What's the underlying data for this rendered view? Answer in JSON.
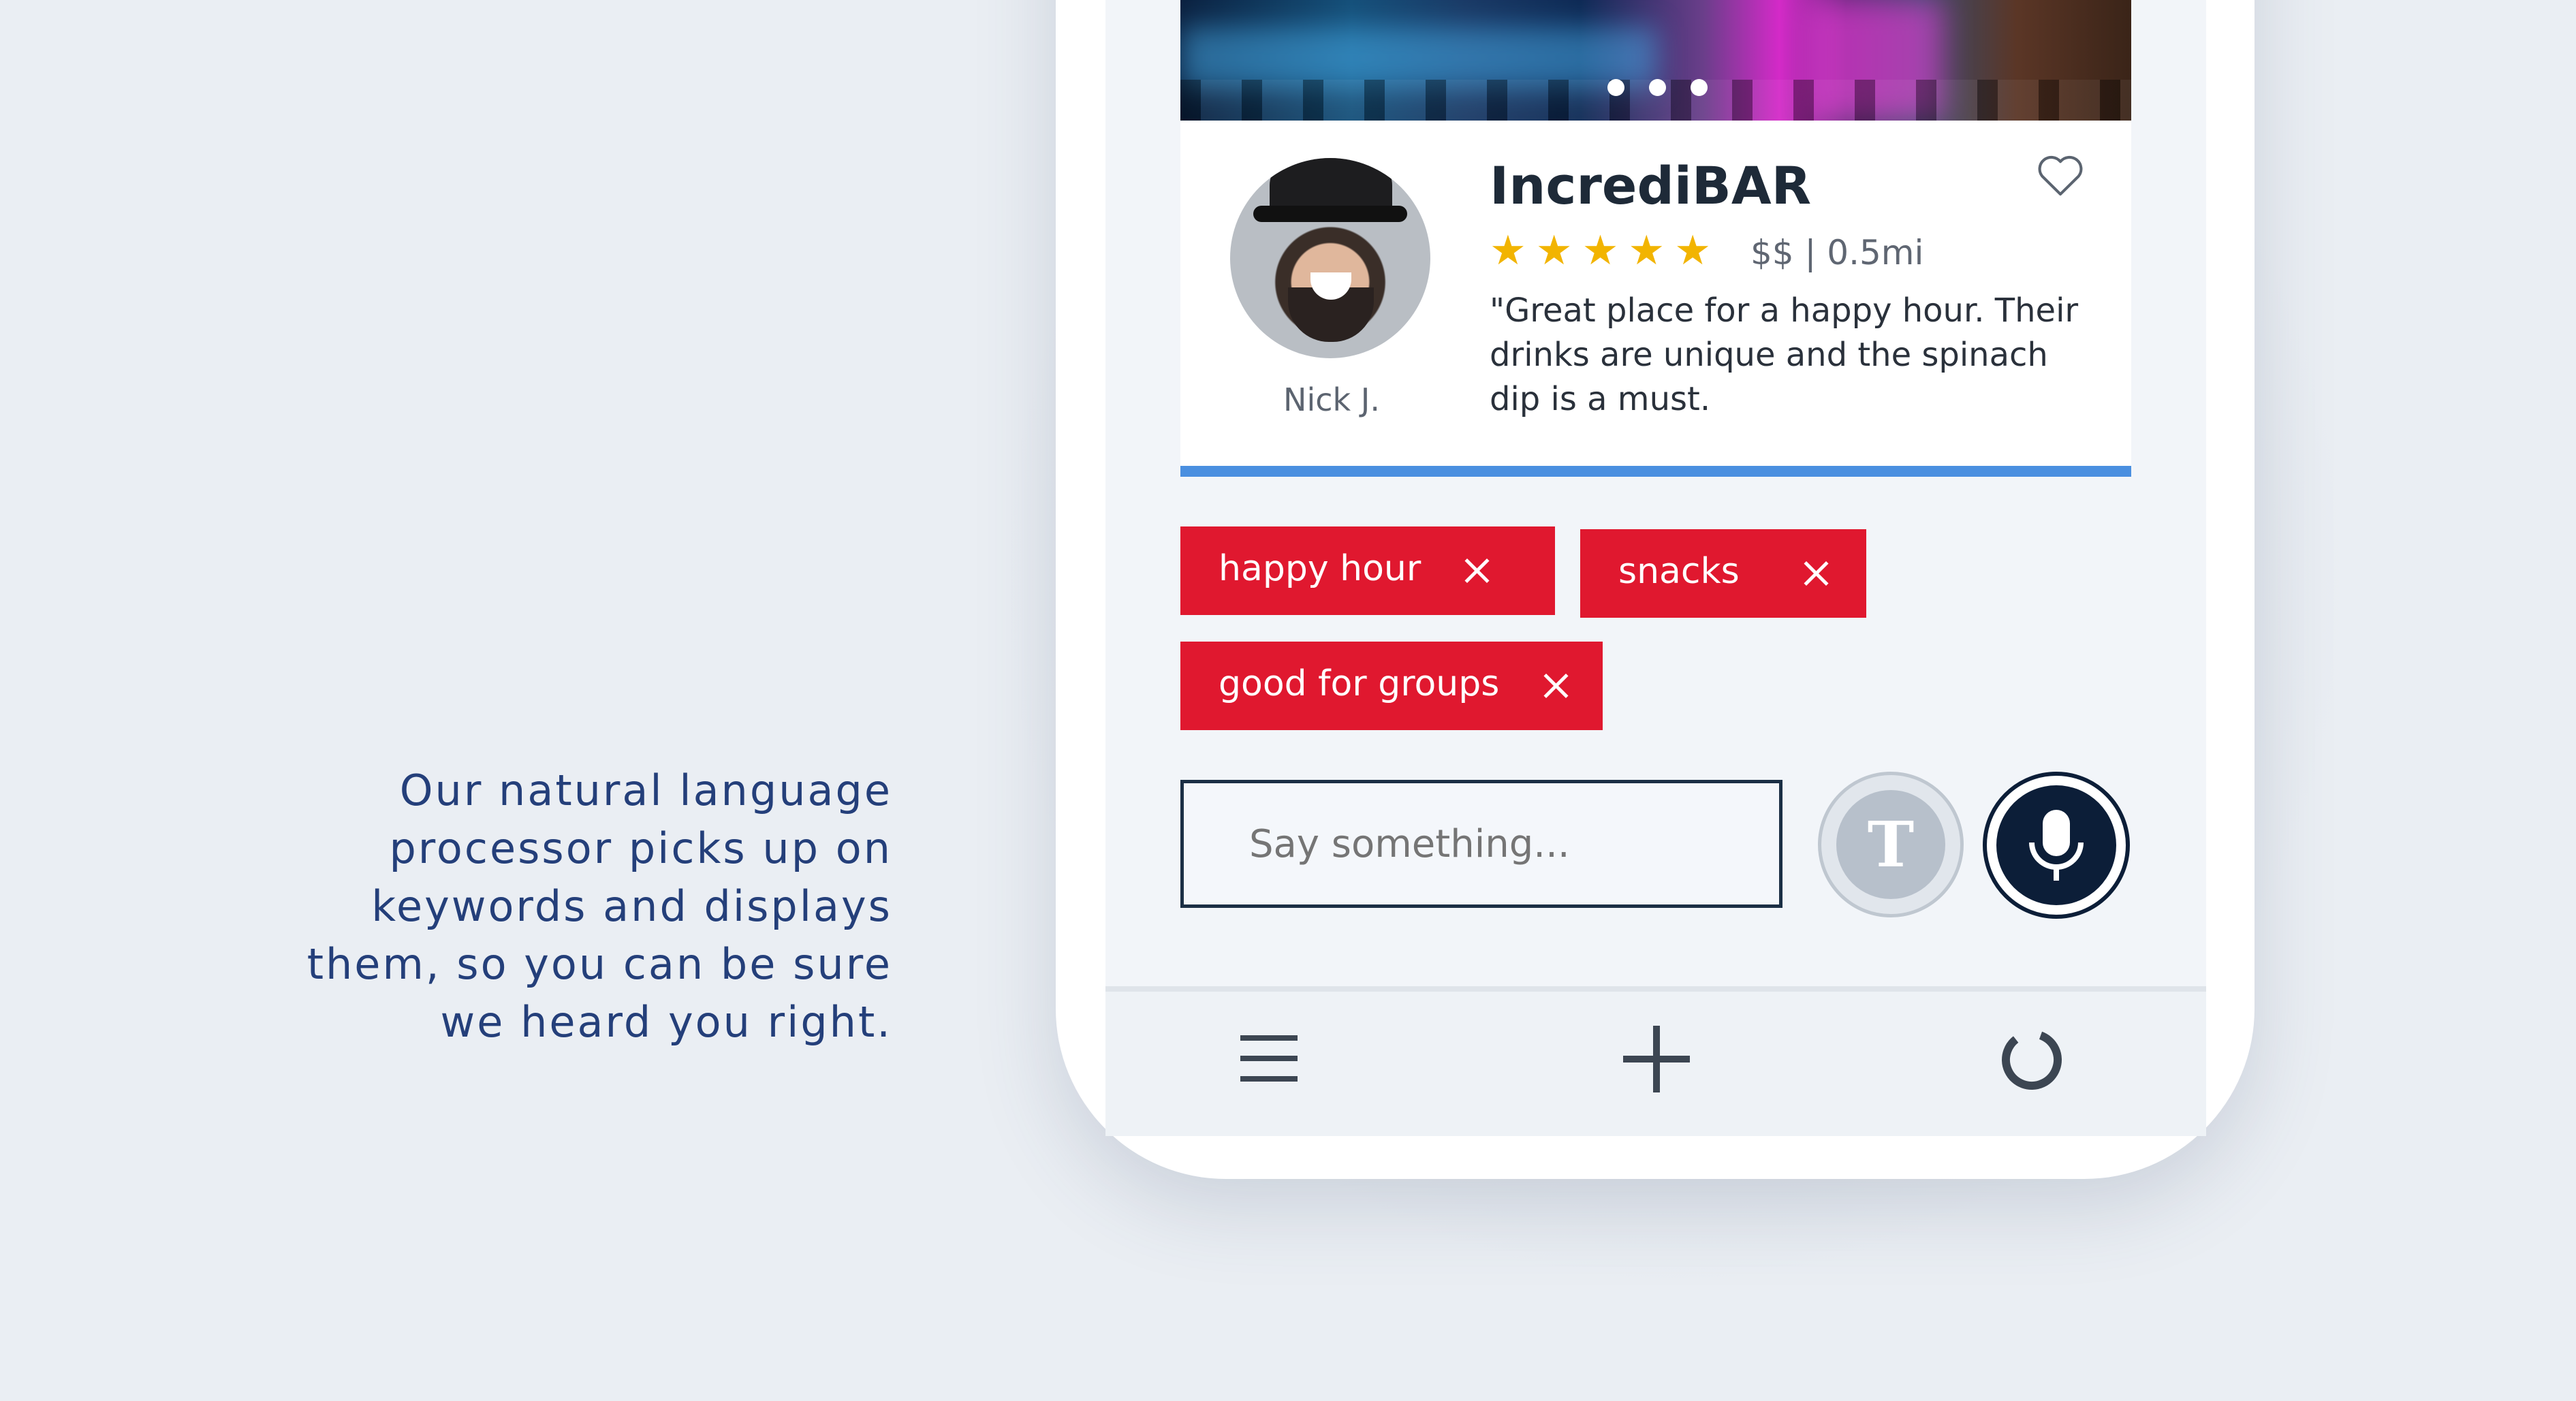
{
  "caption": {
    "lines": [
      "Our natural language",
      "processor picks up on",
      "keywords and displays",
      "them, so you can be sure",
      "we heard you right."
    ]
  },
  "carousel": {
    "dots": 3
  },
  "review": {
    "reviewer_name": "Nick J.",
    "venue_name": "IncrediBAR",
    "rating": 5,
    "rating_max": 5,
    "meta": "$$ | 0.5mi",
    "quote": "\"Great place for a happy hour. Their drinks are unique and the spinach dip is a must."
  },
  "tags": [
    {
      "label": "happy hour"
    },
    {
      "label": "snacks"
    },
    {
      "label": "good for groups"
    }
  ],
  "input": {
    "placeholder": "Say something..."
  },
  "buttons": {
    "text_mode_label": "T"
  },
  "colors": {
    "tag": "#e0182f",
    "accent_bar": "#4a8fe0",
    "star": "#f2b400",
    "mic": "#0c1e38",
    "caption": "#243f7a"
  },
  "icons": {
    "heart": "heart-outline-icon",
    "mic": "microphone-icon",
    "menu": "hamburger-menu-icon",
    "add": "plus-icon",
    "loading": "loading-ring-icon",
    "close": "close-icon"
  }
}
